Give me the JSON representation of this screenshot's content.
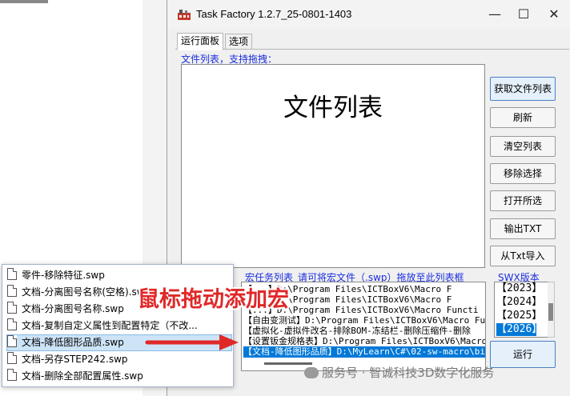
{
  "window": {
    "title": "Task Factory 1.2.7_25-0801-1403",
    "minimize": "—",
    "maximize": "☐",
    "close": "✕"
  },
  "tabs": [
    {
      "label": "运行面板"
    },
    {
      "label": "选项"
    }
  ],
  "file_list": {
    "label": "文件列表，支持拖拽：",
    "watermark": "文件列表"
  },
  "buttons": {
    "get_list": "获取文件列表",
    "refresh": "刷新",
    "clear": "清空列表",
    "remove": "移除选择",
    "open_selected": "打开所选",
    "export_txt": "输出TXT",
    "import_txt": "从Txt导入",
    "run": "运行"
  },
  "swx": {
    "label": "SWX版本",
    "versions": [
      "【2023】",
      "【2024】",
      "【2025】",
      "【2026】"
    ],
    "selected": "【2026】"
  },
  "macro_list": {
    "label": "宏任务列表_请可将宏文件（.swp）拖放至此列表框",
    "rows": [
      "【...】D:\\Program Files\\ICTBoxV6\\Macro F",
      "【...】D:\\Program Files\\ICTBoxV6\\Macro F",
      "【...】D:\\Program Files\\ICTBoxV6\\Macro Functi",
      "【自由变测试】D:\\Program Files\\ICTBoxV6\\Macro Fun",
      "【虚拟化-虚拟件改名-排除BOM-冻结栏-删除压缩件-删除",
      "【设置钣金规格表】D:\\Program Files\\ICTBoxV6\\Macro",
      "【文档-降低图形品质】D:\\MyLearn\\C#\\02-sw-macro\\bin"
    ]
  },
  "drag_popup": {
    "items": [
      "零件-移除特征.swp",
      "文档-分离图号名称(空格).swp",
      "文档-分离图号名称.swp",
      "文档-复制自定义属性到配置特定（不改...",
      "文档-降低图形品质.swp",
      "文档-另存STEP242.swp",
      "文档-删除全部配置属性.swp"
    ]
  },
  "overlay": {
    "caption": "鼠标拖动添加宏"
  },
  "watermark": {
    "text": "服务号 · 智诚科技3D数字化服务"
  },
  "colors": {
    "accent_blue": "#1a2ee0",
    "selection": "#0078d7",
    "caption_red": "#e02828"
  }
}
